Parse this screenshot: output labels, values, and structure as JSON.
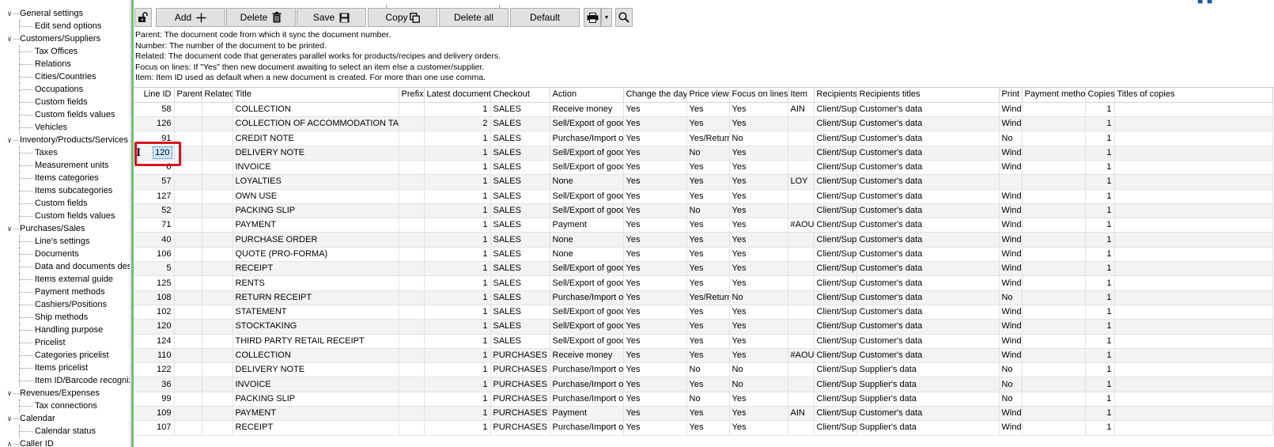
{
  "tree": [
    {
      "label": "General settings",
      "children": [
        "Edit send options"
      ]
    },
    {
      "label": "Customers/Suppliers",
      "children": [
        "Tax Offices",
        "Relations",
        "Cities/Countries",
        "Occupations",
        "Custom fields",
        "Custom fields values",
        "Vehicles"
      ]
    },
    {
      "label": "Inventory/Products/Services",
      "children": [
        "Taxes",
        "Measurement units",
        "Items categories",
        "Items subcategories",
        "Custom fields",
        "Custom fields values"
      ]
    },
    {
      "label": "Purchases/Sales",
      "children": [
        "Line's settings",
        "Documents",
        "Data and documents desi",
        "Items external guide",
        "Payment methods",
        "Cashiers/Positions",
        "Ship methods",
        "Handling purpose",
        "Pricelist",
        "Categories pricelist",
        "Items pricelist",
        "Item ID/Barcode recognize"
      ]
    },
    {
      "label": "Revenues/Expenses",
      "children": [
        "Tax connections"
      ]
    },
    {
      "label": "Calendar",
      "children": [
        "Calendar status"
      ]
    },
    {
      "label": "Caller ID",
      "children": []
    }
  ],
  "toolbar": {
    "add_label": "Add",
    "delete_label": "Delete",
    "save_label": "Save",
    "copy_label": "Copy",
    "delete_all_label": "Delete all",
    "default_label": "Default"
  },
  "info": [
    "Parent: The document code from which it sync the document number.",
    "Number: The number of the document to be printed.",
    "Related: The document code that generates parallel works for products/recipes and delivery orders.",
    "Focus on lines: If \"Yes\" then new document awaiting to select an item else a customer/supplier.",
    "Item: Item ID used as default when a new document is created. For more than one use comma."
  ],
  "grid": {
    "columns": [
      "Line ID",
      "Parent",
      "Related",
      "Title",
      "Prefix",
      "Latest document",
      "Checkout",
      "Action",
      "Change the day",
      "Price view",
      "Focus on lines",
      "Item",
      "Recipients",
      "Recipients titles",
      "Print",
      "Payment method",
      "Copies",
      "Titles of copies"
    ],
    "rows": [
      [
        "58",
        "",
        "",
        "COLLECTION",
        "",
        "1",
        "SALES",
        "Receive money",
        "Yes",
        "Yes",
        "Yes",
        "AIN",
        "Client/Supp",
        "Customer's data",
        "Wind",
        "",
        "1",
        ""
      ],
      [
        "126",
        "",
        "",
        "COLLECTION OF ACCOMMODATION TAX",
        "",
        "2",
        "SALES",
        "Sell/Export of good",
        "Yes",
        "Yes",
        "Yes",
        "",
        "Client/Supp",
        "Customer's data",
        "Wind",
        "",
        "1",
        ""
      ],
      [
        "91",
        "",
        "",
        "CREDIT NOTE",
        "",
        "1",
        "SALES",
        "Purchase/Import of",
        "Yes",
        "Yes/Return",
        "No",
        "",
        "Client/Supp",
        "Customer's data",
        "No",
        "",
        "1",
        ""
      ],
      [
        "120",
        "",
        "",
        "DELIVERY NOTE",
        "",
        "1",
        "SALES",
        "Sell/Export of good",
        "Yes",
        "No",
        "Yes",
        "",
        "Client/Supp",
        "Customer's data",
        "Wind",
        "",
        "1",
        ""
      ],
      [
        "6",
        "",
        "",
        "INVOICE",
        "",
        "1",
        "SALES",
        "Sell/Export of good",
        "Yes",
        "Yes",
        "Yes",
        "",
        "Client/Supp",
        "Customer's data",
        "Wind",
        "",
        "1",
        ""
      ],
      [
        "57",
        "",
        "",
        "LOYALTIES",
        "",
        "1",
        "SALES",
        "None",
        "Yes",
        "Yes",
        "Yes",
        "LOY",
        "Client/Supp",
        "Customer's data",
        "",
        "",
        "1",
        ""
      ],
      [
        "127",
        "",
        "",
        "OWN USE",
        "",
        "1",
        "SALES",
        "Sell/Export of good",
        "Yes",
        "Yes",
        "Yes",
        "",
        "Client/Supp",
        "Customer's data",
        "Wind",
        "",
        "1",
        ""
      ],
      [
        "52",
        "",
        "",
        "PACKING SLIP",
        "",
        "1",
        "SALES",
        "Sell/Export of good",
        "Yes",
        "No",
        "Yes",
        "",
        "Client/Supp",
        "Customer's data",
        "Wind",
        "",
        "1",
        ""
      ],
      [
        "71",
        "",
        "",
        "PAYMENT",
        "",
        "1",
        "SALES",
        "Payment",
        "Yes",
        "Yes",
        "Yes",
        "#AOU",
        "Client/Supp",
        "Customer's data",
        "Wind",
        "",
        "1",
        ""
      ],
      [
        "40",
        "",
        "",
        "PURCHASE ORDER",
        "",
        "1",
        "SALES",
        "None",
        "Yes",
        "Yes",
        "Yes",
        "",
        "Client/Supp",
        "Customer's data",
        "Wind",
        "",
        "1",
        ""
      ],
      [
        "106",
        "",
        "",
        "QUOTE (PRO-FORMA)",
        "",
        "1",
        "SALES",
        "None",
        "Yes",
        "Yes",
        "Yes",
        "",
        "Client/Supp",
        "Customer's data",
        "Wind",
        "",
        "1",
        ""
      ],
      [
        "5",
        "",
        "",
        "RECEIPT",
        "",
        "1",
        "SALES",
        "Sell/Export of good",
        "Yes",
        "Yes",
        "Yes",
        "",
        "Client/Supp",
        "Customer's data",
        "Wind",
        "",
        "1",
        ""
      ],
      [
        "125",
        "",
        "",
        "RENTS",
        "",
        "1",
        "SALES",
        "Sell/Export of good",
        "Yes",
        "Yes",
        "Yes",
        "",
        "Client/Supp",
        "Customer's data",
        "Wind",
        "",
        "1",
        ""
      ],
      [
        "108",
        "",
        "",
        "RETURN RECEIPT",
        "",
        "1",
        "SALES",
        "Purchase/Import of",
        "Yes",
        "Yes/Return",
        "No",
        "",
        "Client/Supp",
        "Customer's data",
        "No",
        "",
        "1",
        ""
      ],
      [
        "102",
        "",
        "",
        "STATEMENT",
        "",
        "1",
        "SALES",
        "Sell/Export of good",
        "Yes",
        "Yes",
        "Yes",
        "",
        "Client/Supp",
        "Customer's data",
        "Wind",
        "",
        "1",
        ""
      ],
      [
        "120",
        "",
        "",
        "STOCKTAKING",
        "",
        "1",
        "SALES",
        "Sell/Export of good",
        "Yes",
        "Yes",
        "Yes",
        "",
        "Client/Supp",
        "Customer's data",
        "Wind",
        "",
        "1",
        ""
      ],
      [
        "124",
        "",
        "",
        "THIRD PARTY RETAIL RECEIPT",
        "",
        "1",
        "SALES",
        "Sell/Export of good",
        "Yes",
        "Yes",
        "Yes",
        "",
        "Client/Supp",
        "Customer's data",
        "Wind",
        "",
        "1",
        ""
      ],
      [
        "110",
        "",
        "",
        "COLLECTION",
        "",
        "1",
        "PURCHASES",
        "Receive money",
        "Yes",
        "Yes",
        "Yes",
        "#AOU",
        "Client/Supp",
        "Customer's data",
        "Wind",
        "",
        "1",
        ""
      ],
      [
        "122",
        "",
        "",
        "DELIVERY NOTE",
        "",
        "1",
        "PURCHASES",
        "Purchase/Import of",
        "Yes",
        "No",
        "No",
        "",
        "Client/Supp",
        "Supplier's data",
        "No",
        "",
        "1",
        ""
      ],
      [
        "36",
        "",
        "",
        "INVOICE",
        "",
        "1",
        "PURCHASES",
        "Purchase/Import of",
        "Yes",
        "Yes",
        "No",
        "",
        "Client/Supp",
        "Supplier's data",
        "No",
        "",
        "1",
        ""
      ],
      [
        "99",
        "",
        "",
        "PACKING SLIP",
        "",
        "1",
        "PURCHASES",
        "Purchase/Import of",
        "Yes",
        "No",
        "Yes",
        "",
        "Client/Supp",
        "Supplier's data",
        "No",
        "",
        "1",
        ""
      ],
      [
        "109",
        "",
        "",
        "PAYMENT",
        "",
        "1",
        "PURCHASES",
        "Payment",
        "Yes",
        "Yes",
        "Yes",
        "AIN",
        "Client/Supp",
        "Customer's data",
        "Wind",
        "",
        "1",
        ""
      ],
      [
        "107",
        "",
        "",
        "RECEIPT",
        "",
        "1",
        "PURCHASES",
        "Purchase/Import of",
        "Yes",
        "Yes",
        "Yes",
        "",
        "Client/Supp",
        "Supplier's data",
        "Wind",
        "",
        "1",
        ""
      ]
    ],
    "selected_row": 3
  }
}
